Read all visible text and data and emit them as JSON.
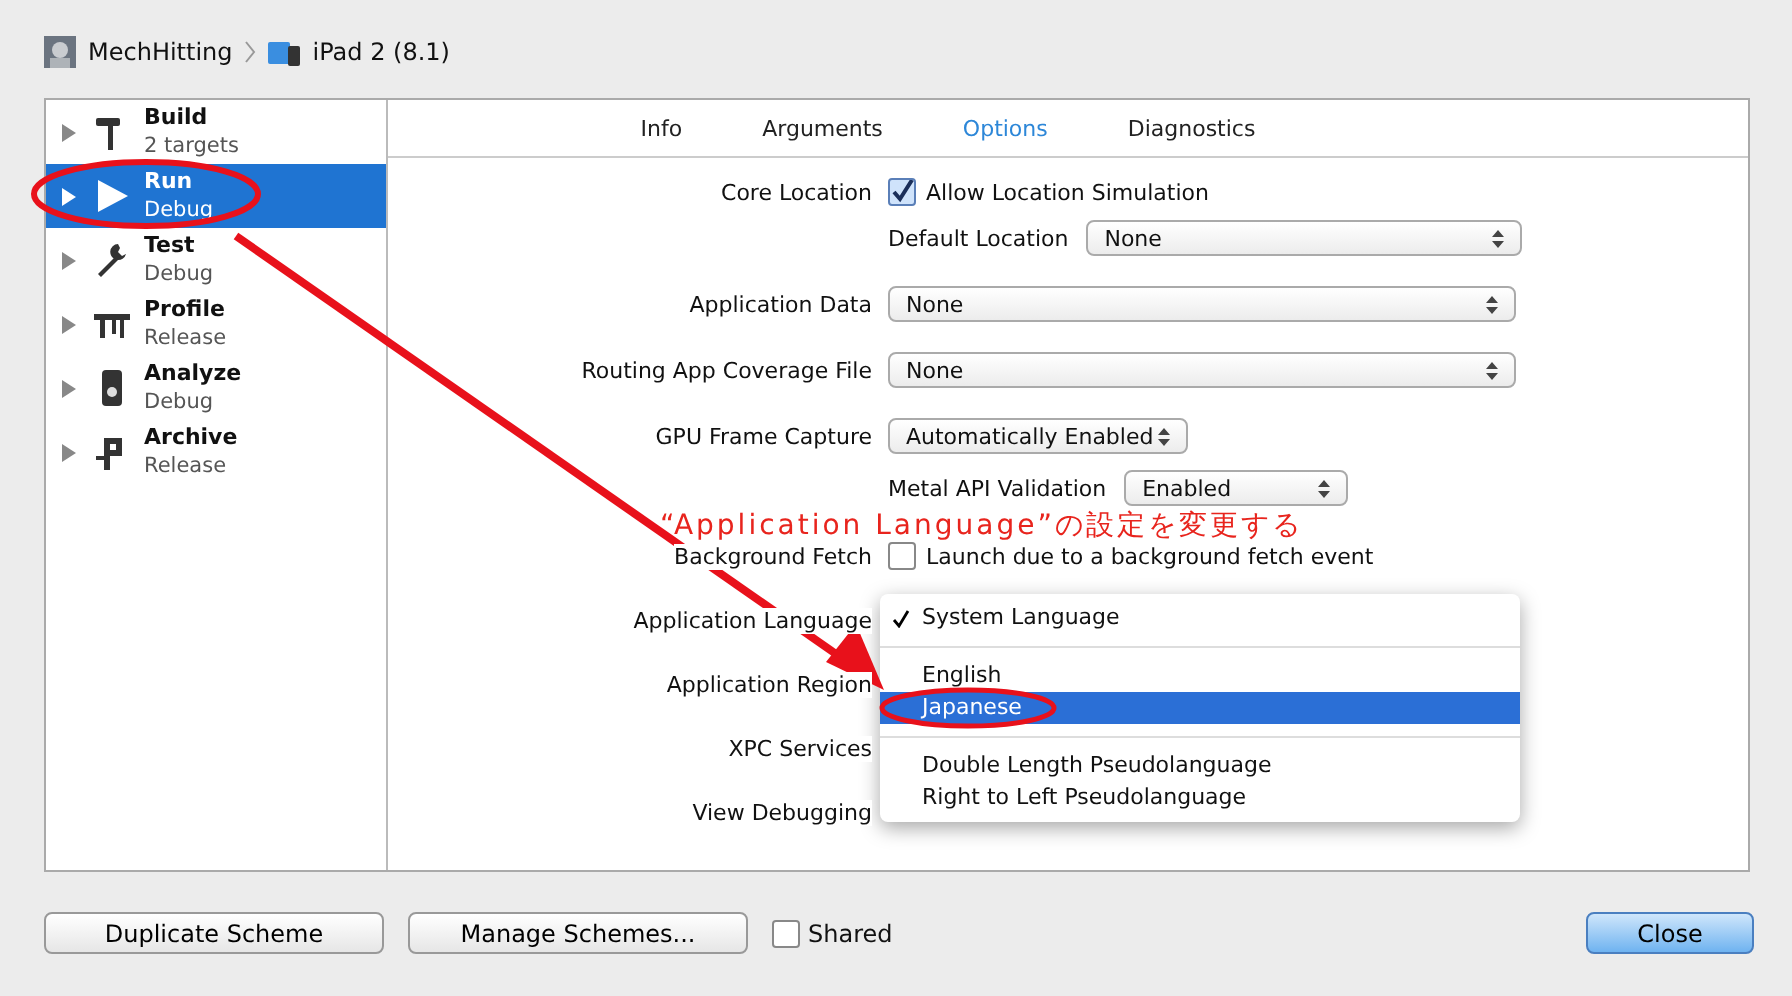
{
  "breadcrumb": {
    "project": "MechHitting",
    "device": "iPad 2 (8.1)"
  },
  "sidebar": {
    "items": [
      {
        "kind": "hammer",
        "title": "Build",
        "subtitle": "2 targets",
        "selected": false
      },
      {
        "kind": "play",
        "title": "Run",
        "subtitle": "Debug",
        "selected": true
      },
      {
        "kind": "wrench",
        "title": "Test",
        "subtitle": "Debug",
        "selected": false
      },
      {
        "kind": "gauge",
        "title": "Profile",
        "subtitle": "Release",
        "selected": false
      },
      {
        "kind": "device",
        "title": "Analyze",
        "subtitle": "Debug",
        "selected": false
      },
      {
        "kind": "clamp",
        "title": "Archive",
        "subtitle": "Release",
        "selected": false
      }
    ]
  },
  "tabs": [
    {
      "label": "Info",
      "selected": false
    },
    {
      "label": "Arguments",
      "selected": false
    },
    {
      "label": "Options",
      "selected": true
    },
    {
      "label": "Diagnostics",
      "selected": false
    }
  ],
  "options": [
    {
      "kind": "checkbox",
      "label": "Core Location",
      "checked": true,
      "text": "Allow Location Simulation"
    },
    {
      "kind": "subselect",
      "label": "Default Location",
      "value": "None"
    },
    {
      "kind": "select",
      "label": "Application Data",
      "value": "None"
    },
    {
      "kind": "select",
      "label": "Routing App Coverage File",
      "value": "None"
    },
    {
      "kind": "popup",
      "label": "GPU Frame Capture",
      "value": "Automatically Enabled"
    },
    {
      "kind": "subpopup",
      "label": "Metal API Validation",
      "value": "Enabled"
    },
    {
      "kind": "checkbox",
      "label": "Background Fetch",
      "checked": false,
      "text": "Launch due to a background fetch event"
    },
    {
      "kind": "covered",
      "label": "Application Language"
    },
    {
      "kind": "covered",
      "label": "Application Region"
    },
    {
      "kind": "covered",
      "label": "XPC Services"
    },
    {
      "kind": "covered",
      "label": "View Debugging"
    }
  ],
  "menu": {
    "items": [
      {
        "kind": "item",
        "label": "System Language",
        "checked": true,
        "selected": false
      },
      {
        "kind": "separator"
      },
      {
        "kind": "item",
        "label": "English",
        "checked": false,
        "selected": false
      },
      {
        "kind": "item",
        "label": "Japanese",
        "checked": false,
        "selected": true
      },
      {
        "kind": "separator"
      },
      {
        "kind": "item",
        "label": "Double Length Pseudolanguage",
        "checked": false,
        "selected": false
      },
      {
        "kind": "item",
        "label": "Right to Left Pseudolanguage",
        "checked": false,
        "selected": false
      }
    ]
  },
  "footer": {
    "buttons": [
      "Duplicate Scheme",
      "Manage Schemes..."
    ],
    "shared": {
      "label": "Shared",
      "checked": false
    },
    "close": "Close"
  },
  "annotation": {
    "text": "“Application Language”の設定を変更する"
  }
}
